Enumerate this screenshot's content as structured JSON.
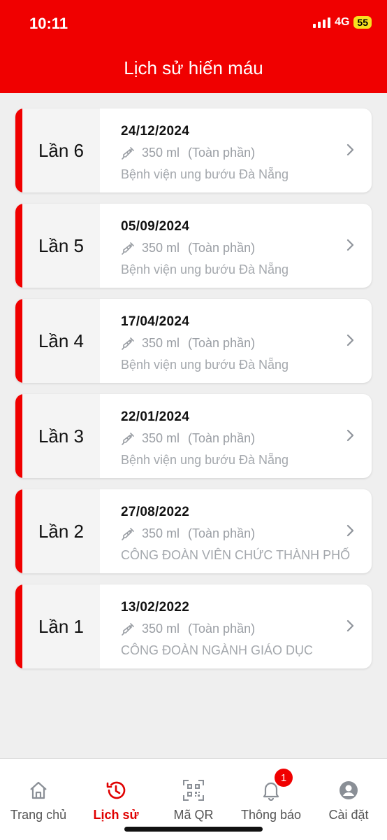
{
  "status_bar": {
    "time": "10:11",
    "network": "4G",
    "battery": "55"
  },
  "header": {
    "title": "Lịch sử hiến máu"
  },
  "donations": [
    {
      "label": "Lần 6",
      "date": "24/12/2024",
      "volume": "350 ml",
      "type": "(Toàn phần)",
      "location": "Bệnh viện ung bướu Đà Nẵng"
    },
    {
      "label": "Lần 5",
      "date": "05/09/2024",
      "volume": "350 ml",
      "type": "(Toàn phần)",
      "location": "Bệnh viện ung bướu Đà Nẵng"
    },
    {
      "label": "Lần 4",
      "date": "17/04/2024",
      "volume": "350 ml",
      "type": "(Toàn phần)",
      "location": "Bệnh viện ung bướu Đà Nẵng"
    },
    {
      "label": "Lần 3",
      "date": "22/01/2024",
      "volume": "350 ml",
      "type": "(Toàn phần)",
      "location": "Bệnh viện ung bướu Đà Nẵng"
    },
    {
      "label": "Lần 2",
      "date": "27/08/2022",
      "volume": "350 ml",
      "type": "(Toàn phần)",
      "location": "CÔNG ĐOÀN VIÊN CHỨC THÀNH PHỐ"
    },
    {
      "label": "Lần 1",
      "date": "13/02/2022",
      "volume": "350 ml",
      "type": "(Toàn phần)",
      "location": "CÔNG ĐOÀN NGÀNH GIÁO DỤC"
    }
  ],
  "tabs": [
    {
      "label": "Trang chủ",
      "icon": "home-icon",
      "active": false
    },
    {
      "label": "Lịch sử",
      "icon": "history-icon",
      "active": true
    },
    {
      "label": "Mã QR",
      "icon": "qr-code-icon",
      "active": false
    },
    {
      "label": "Thông báo",
      "icon": "bell-icon",
      "active": false,
      "badge": "1"
    },
    {
      "label": "Cài đặt",
      "icon": "account-icon",
      "active": false
    }
  ],
  "colors": {
    "brand": "#f00000",
    "active_tab": "#e00000",
    "muted_text": "#9a9ea4"
  }
}
